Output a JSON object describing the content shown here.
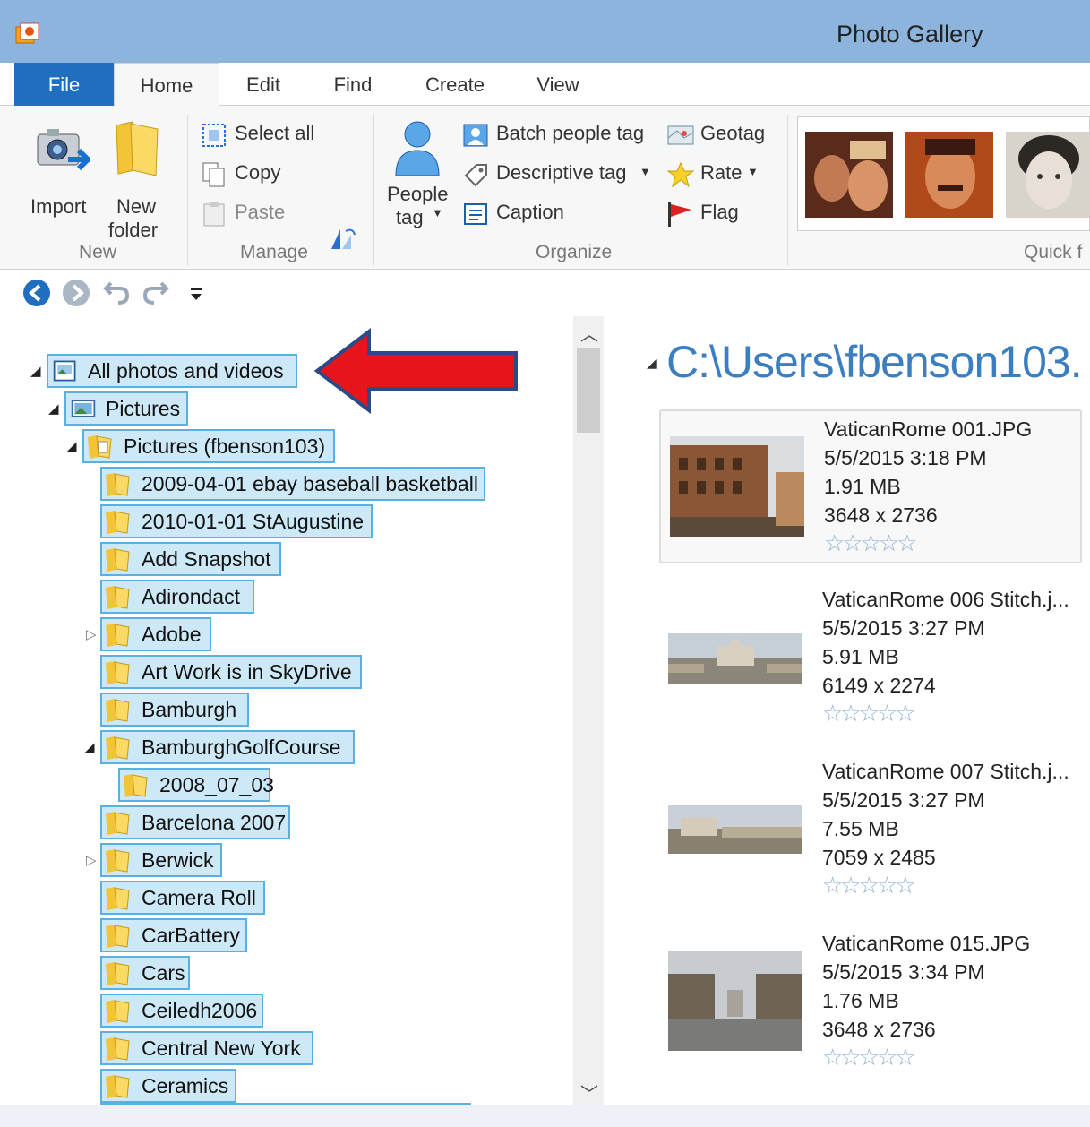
{
  "window": {
    "title": "Photo Gallery"
  },
  "tabs": [
    "File",
    "Home",
    "Edit",
    "Find",
    "Create",
    "View"
  ],
  "ribbon": {
    "new": {
      "import": "Import",
      "new_folder_1": "New",
      "new_folder_2": "folder",
      "group": "New"
    },
    "manage": {
      "select_all": "Select all",
      "copy": "Copy",
      "paste": "Paste",
      "group": "Manage"
    },
    "organize": {
      "people_1": "People",
      "people_2": "tag",
      "batch": "Batch people tag",
      "descriptive": "Descriptive tag",
      "caption": "Caption",
      "geotag": "Geotag",
      "rate": "Rate",
      "flag": "Flag",
      "group": "Organize"
    },
    "quick_find": {
      "group": "Quick f"
    }
  },
  "nav": {
    "tree": [
      {
        "label": "All photos and videos",
        "expanded": true
      },
      {
        "label": "Pictures",
        "expanded": true
      },
      {
        "label": "Pictures (fbenson103)",
        "expanded": true
      },
      {
        "label": "2009-04-01 ebay baseball basketball"
      },
      {
        "label": "2010-01-01 StAugustine"
      },
      {
        "label": "Add Snapshot"
      },
      {
        "label": "Adirondact"
      },
      {
        "label": "Adobe",
        "collapsed": true
      },
      {
        "label": "Art Work is in SkyDrive"
      },
      {
        "label": "Bamburgh"
      },
      {
        "label": "BamburghGolfCourse",
        "expanded": true
      },
      {
        "label": "2008_07_03"
      },
      {
        "label": "Barcelona 2007"
      },
      {
        "label": "Berwick",
        "collapsed": true
      },
      {
        "label": "Camera Roll"
      },
      {
        "label": "CarBattery"
      },
      {
        "label": "Cars"
      },
      {
        "label": "Ceiledh2006"
      },
      {
        "label": "Central New York"
      },
      {
        "label": "Ceramics"
      }
    ]
  },
  "content": {
    "path": "C:\\Users\\fbenson103.",
    "items": [
      {
        "name": "VaticanRome 001.JPG",
        "date": "5/5/2015 3:18 PM",
        "size": "1.91 MB",
        "dims": "3648 x 2736",
        "stars": "☆☆☆☆☆"
      },
      {
        "name": "VaticanRome 006 Stitch.j...",
        "date": "5/5/2015 3:27 PM",
        "size": "5.91 MB",
        "dims": "6149 x 2274",
        "stars": "☆☆☆☆☆"
      },
      {
        "name": "VaticanRome 007 Stitch.j...",
        "date": "5/5/2015 3:27 PM",
        "size": "7.55 MB",
        "dims": "7059 x 2485",
        "stars": "☆☆☆☆☆"
      },
      {
        "name": "VaticanRome 015.JPG",
        "date": "5/5/2015 3:34 PM",
        "size": "1.76 MB",
        "dims": "3648 x 2736",
        "stars": "☆☆☆☆☆"
      }
    ]
  },
  "colors": {
    "accent": "#1f6ec0",
    "titlebar": "#8cb4dc",
    "selection": "#cde8f7",
    "arrow": "#e8141c"
  }
}
